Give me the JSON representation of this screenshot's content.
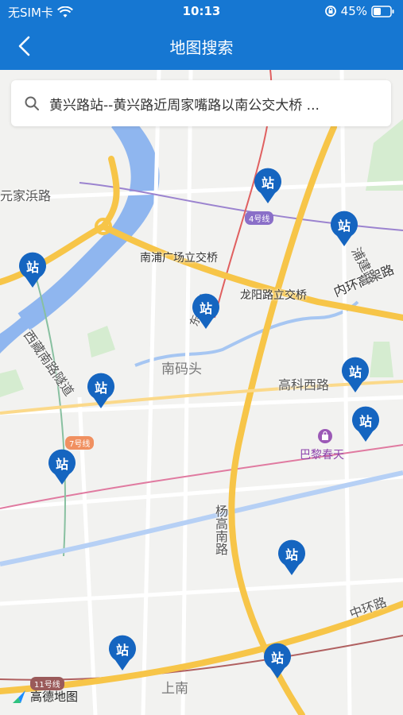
{
  "status_bar": {
    "carrier": "无SIM卡",
    "time": "10:13",
    "battery": "45%"
  },
  "nav": {
    "title": "地图搜索",
    "back_icon": "chevron-left-icon"
  },
  "search": {
    "text": "黄兴路站--黄兴路近周家嘴路以南公交大桥 ..."
  },
  "map": {
    "station_label": "站",
    "labels": {
      "jiajiabang": "元家浜路",
      "nanpu": "南浦广场立交桥",
      "longyang": "龙阳路立交桥",
      "neihuan": "内环高架路",
      "pujian": "浦建路",
      "xizang": "西藏南路隧道",
      "nanmatou": "南码头",
      "gaoke": "高科西路",
      "yanggao": "杨高南路",
      "zhonghuan": "中环路",
      "shangnan": "上南",
      "bali": "巴黎春天",
      "dongfang": "东方路"
    },
    "metro": {
      "line4": "4号线",
      "line7": "7号线",
      "line11": "11号线"
    },
    "attribution": "高德地图",
    "colors": {
      "pin": "#1565c0",
      "river": "#8fb6ef",
      "arterial": "#f7c548",
      "topbar": "#1677d2"
    }
  }
}
